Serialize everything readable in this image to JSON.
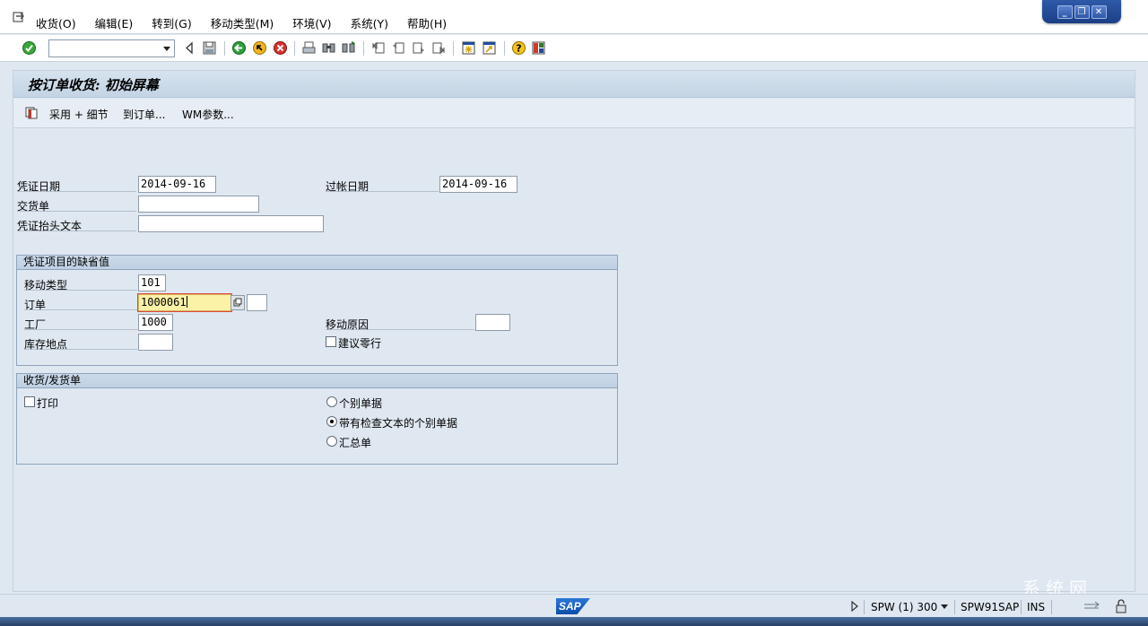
{
  "menu": {
    "items": [
      "收货(O)",
      "编辑(E)",
      "转到(G)",
      "移动类型(M)",
      "环境(V)",
      "系统(Y)",
      "帮助(H)"
    ]
  },
  "window_controls": {
    "minimize": "_",
    "restore": "❐",
    "close": "✕"
  },
  "toolbar": {
    "command_field_value": "",
    "icons": [
      "enter-icon",
      "back-triangle-icon",
      "save-icon",
      "back-icon",
      "exit-icon",
      "cancel-icon",
      "print-icon",
      "find-icon",
      "find-next-icon",
      "first-page-icon",
      "previous-page-icon",
      "next-page-icon",
      "last-page-icon",
      "new-session-icon",
      "shortcut-icon",
      "help-icon",
      "layout-icon"
    ]
  },
  "screen": {
    "title": "按订单收货: 初始屏幕",
    "app_buttons": {
      "adopt_detail": "采用 + 细节",
      "to_order": "到订单...",
      "wm_params": "WM参数..."
    }
  },
  "header": {
    "doc_date_label": "凭证日期",
    "doc_date": "2014-09-16",
    "posting_date_label": "过帐日期",
    "posting_date": "2014-09-16",
    "delivery_note_label": "交货单",
    "delivery_note": "",
    "header_text_label": "凭证抬头文本",
    "header_text": ""
  },
  "defaults_group": {
    "title": "凭证项目的缺省值",
    "movement_type_label": "移动类型",
    "movement_type": "101",
    "order_label": "订单",
    "order": "1000061",
    "order_item": "",
    "plant_label": "工厂",
    "plant": "1000",
    "reason_label": "移动原因",
    "reason": "",
    "storage_location_label": "库存地点",
    "storage_location": "",
    "suggest_zero_lines_label": "建议零行",
    "suggest_zero_lines": false
  },
  "slip_group": {
    "title": "收货/发货单",
    "print_label": "打印",
    "print": false,
    "options": [
      "个别单据",
      "带有检查文本的个别单据",
      "汇总单"
    ],
    "selected_option": "带有检查文本的个别单据"
  },
  "status": {
    "system": "SPW (1) 300",
    "server": "SPW91SAP",
    "mode": "INS",
    "logo_text": "SAP"
  },
  "watermark": "系统网"
}
